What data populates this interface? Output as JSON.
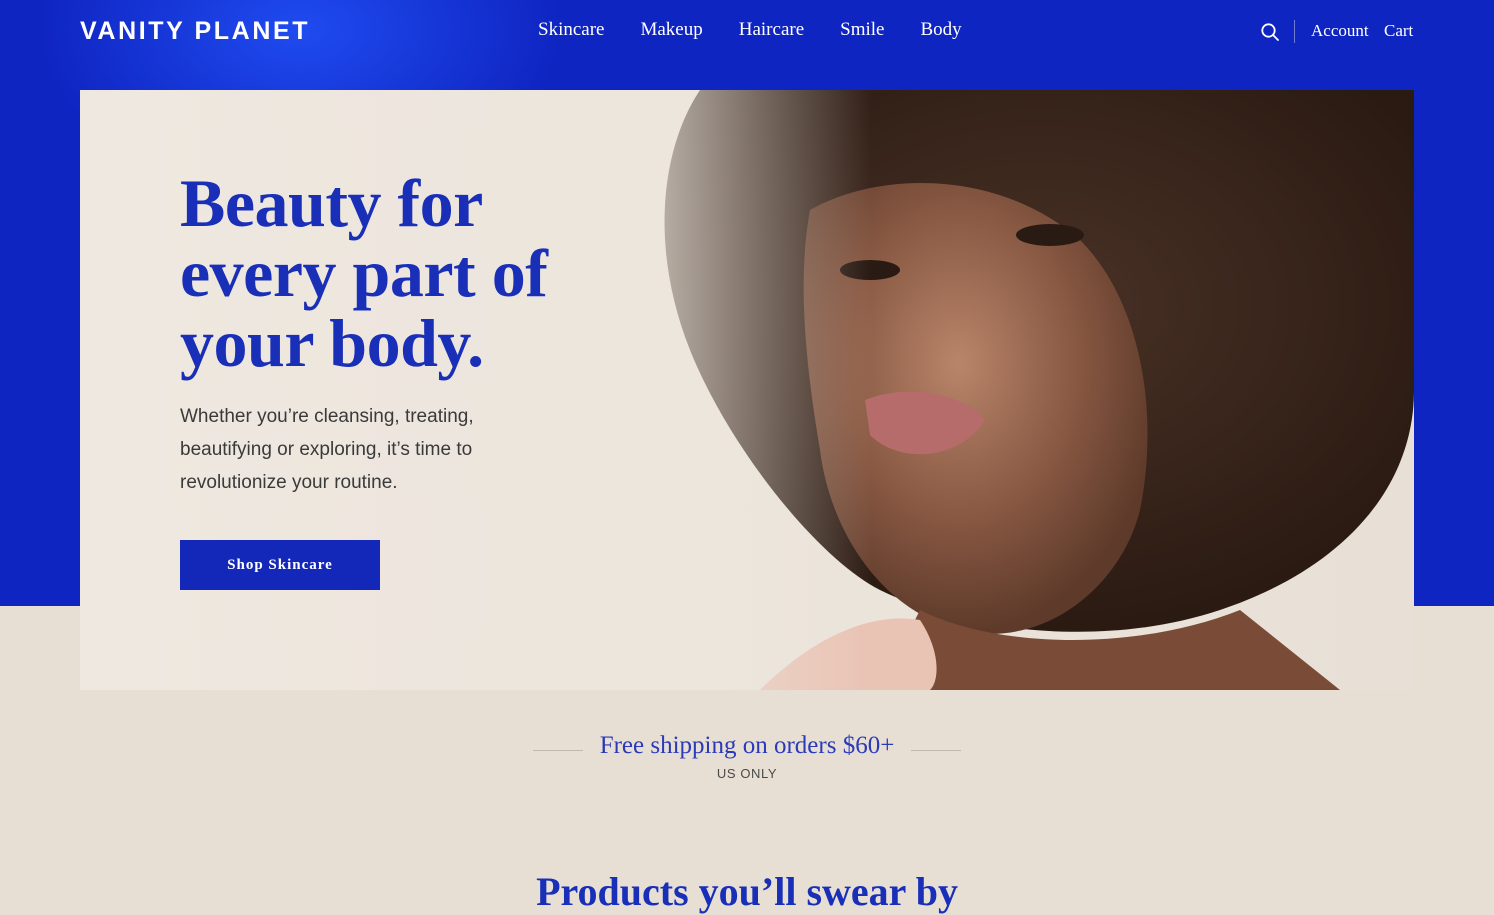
{
  "brand": {
    "logo": "VANITY PLANET"
  },
  "nav": {
    "items": [
      {
        "label": "Skincare"
      },
      {
        "label": "Makeup"
      },
      {
        "label": "Haircare"
      },
      {
        "label": "Smile"
      },
      {
        "label": "Body"
      }
    ]
  },
  "utility": {
    "search_icon": "search-icon",
    "account_label": "Account",
    "cart_label": "Cart"
  },
  "hero": {
    "title": "Beauty for every part of your body.",
    "subtitle": "Whether you’re cleansing, treating, beautifying or exploring, it’s time to revolutionize your routine.",
    "cta_label": "Shop Skincare"
  },
  "shipping": {
    "title": "Free shipping on orders $60+",
    "subtitle": "US ONLY"
  },
  "products": {
    "heading": "Products you’ll swear by"
  },
  "colors": {
    "brand_blue": "#0f25c2",
    "accent_blue": "#1a2fb8",
    "background_beige": "#e8dfd4"
  }
}
